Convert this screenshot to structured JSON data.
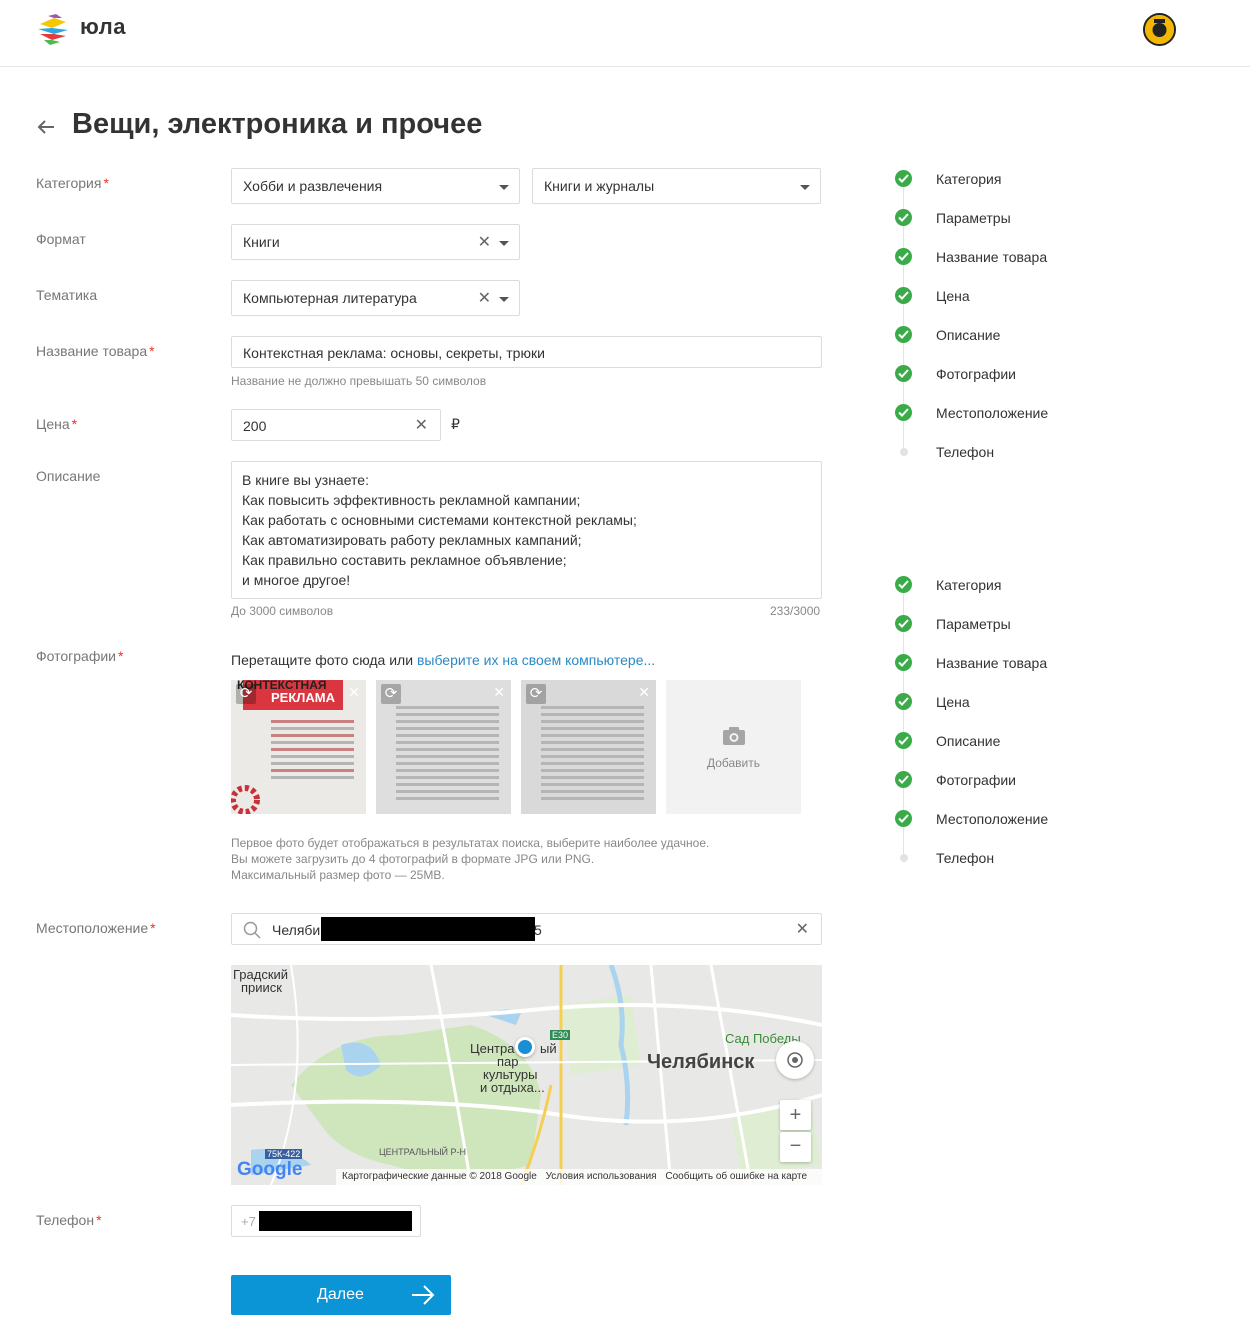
{
  "brand": {
    "name": "юла"
  },
  "page": {
    "title": "Вещи, электроника и прочее"
  },
  "form": {
    "category": {
      "label": "Категория",
      "value1": "Хобби и развлечения",
      "value2": "Книги и журналы"
    },
    "format": {
      "label": "Формат",
      "value": "Книги"
    },
    "theme": {
      "label": "Тематика",
      "value": "Компьютерная литература"
    },
    "name": {
      "label": "Название товара",
      "value": "Контекстная реклама: основы, секреты, трюки",
      "hint": "Название не должно превышать 50 символов"
    },
    "price": {
      "label": "Цена",
      "value": "200",
      "currency": "₽"
    },
    "description": {
      "label": "Описание",
      "lines": [
        "В книге вы узнаете:",
        "Как повысить эффективность рекламной кампании;",
        "Как работать с основными системами контекстной рекламы;",
        "Как автоматизировать работу рекламных кампаний;",
        "Как правильно составить рекламное объявление;",
        "и многое другое!"
      ],
      "hint": "До 3000 символов",
      "counter": "233/3000"
    },
    "photos": {
      "label": "Фотографии",
      "drop_text": "Перетащите фото сюда или ",
      "drop_link": "выберите их на своем компьютере...",
      "add_label": "Добавить",
      "thumb1_title": "КОНТЕКСТНАЯ",
      "thumb1_subtitle": "РЕКЛАМА",
      "hints": [
        "Первое фото будет отображаться в результатах поиска, выберите наиболее удачное.",
        "Вы можете загрузить до 4 фотографий в формате JPG или PNG.",
        "Максимальный размер фото — 25MB."
      ]
    },
    "location": {
      "label": "Местоположение",
      "value_start": "Челяби",
      "value_end": "5",
      "map": {
        "labels": {
          "gradsky": "Градский",
          "priisk": "прииск",
          "sad": "Сад Победы",
          "city": "Челябинск",
          "park1": "Центра",
          "park1b": "ый",
          "park2": "пар",
          "park3": "культуры",
          "park4": "и отдыха...",
          "district": "ЦЕНТРАЛЬНЫЙ Р-Н",
          "road1": "E30",
          "road2": "75К-422",
          "google": "Google"
        },
        "footer": {
          "data": "Картографические данные © 2018 Google",
          "terms": "Условия использования",
          "report": "Сообщить об ошибке на карте"
        }
      }
    },
    "phone": {
      "label": "Телефон",
      "prefix": "+7"
    },
    "submit": {
      "label": "Далее"
    }
  },
  "steps": [
    {
      "label": "Категория",
      "done": true
    },
    {
      "label": "Параметры",
      "done": true
    },
    {
      "label": "Название товара",
      "done": true
    },
    {
      "label": "Цена",
      "done": true
    },
    {
      "label": "Описание",
      "done": true
    },
    {
      "label": "Фотографии",
      "done": true
    },
    {
      "label": "Местоположение",
      "done": true
    },
    {
      "label": "Телефон",
      "done": false
    }
  ],
  "colors": {
    "accent": "#0b94d6",
    "success": "#3bab4a",
    "required": "#e5352b",
    "link": "#2a8ac4"
  }
}
